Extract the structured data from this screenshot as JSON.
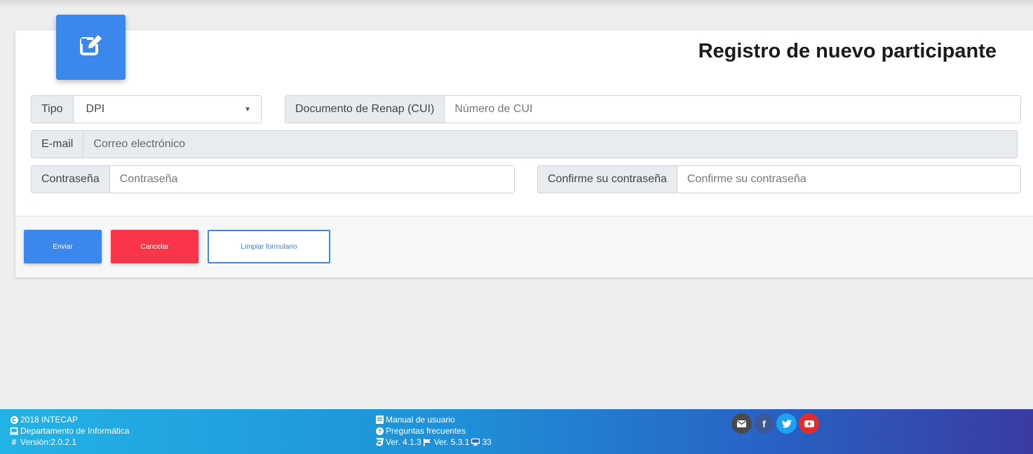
{
  "form": {
    "title": "Registro de nuevo participante",
    "tipo_label": "Tipo",
    "tipo_value": "DPI",
    "cui_label": "Documento de Renap (CUI)",
    "cui_placeholder": "Número de CUI",
    "email_label": "E-mail",
    "email_placeholder": "Correo electrónico",
    "password_label": "Contraseña",
    "password_placeholder": "Contraseña",
    "confirm_label": "Confirme su contraseña",
    "confirm_placeholder": "Confirme su contraseña"
  },
  "actions": {
    "send": "Enviar",
    "cancel": "Cancelar",
    "clear": "Limpiar formulario"
  },
  "footer": {
    "copyright": "2018 INTECAP",
    "department": "Departamento de Informática",
    "version": "Versión:2.0.2.1",
    "manual": "Manual de usuario",
    "faq": "Preguntas frecuentes",
    "ver1": "Ver. 4.1.3",
    "ver2": "Ver. 5.3.1",
    "count": "33"
  },
  "colors": {
    "primary": "#3c87ec",
    "danger": "#fb3549",
    "social_mail": "#4a4a4a",
    "social_facebook": "#3b5998",
    "social_twitter": "#1da1f2",
    "social_youtube": "#e52d27"
  },
  "icons": {
    "header": "edit-icon",
    "copyright": "copyright-icon",
    "department": "laptop-icon",
    "version": "hashtag-icon",
    "manual": "book-icon",
    "faq": "question-circle-icon",
    "css": "css3-icon",
    "flag": "flag-icon",
    "screen": "desktop-icon",
    "social": [
      "envelope-icon",
      "facebook-icon",
      "twitter-icon",
      "youtube-icon"
    ]
  }
}
